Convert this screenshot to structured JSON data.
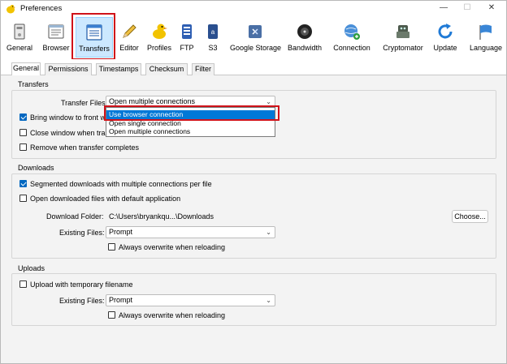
{
  "window": {
    "title": "Preferences",
    "controls": {
      "minimize": "—",
      "maximize": "☐",
      "close": "✕"
    }
  },
  "toolbar": {
    "items": [
      {
        "label": "General",
        "icon": "general-icon"
      },
      {
        "label": "Browser",
        "icon": "browser-icon"
      },
      {
        "label": "Transfers",
        "icon": "transfers-icon",
        "selected": true
      },
      {
        "label": "Editor",
        "icon": "editor-icon"
      },
      {
        "label": "Profiles",
        "icon": "profiles-icon"
      },
      {
        "label": "FTP",
        "icon": "ftp-icon"
      },
      {
        "label": "S3",
        "icon": "s3-icon"
      },
      {
        "label": "Google Storage",
        "icon": "google-storage-icon"
      },
      {
        "label": "Bandwidth",
        "icon": "bandwidth-icon"
      },
      {
        "label": "Connection",
        "icon": "connection-icon"
      },
      {
        "label": "Cryptomator",
        "icon": "cryptomator-icon"
      },
      {
        "label": "Update",
        "icon": "update-icon"
      },
      {
        "label": "Language",
        "icon": "language-icon"
      }
    ]
  },
  "tabs": [
    {
      "label": "General",
      "active": true
    },
    {
      "label": "Permissions"
    },
    {
      "label": "Timestamps"
    },
    {
      "label": "Checksum"
    },
    {
      "label": "Filter"
    }
  ],
  "transfers": {
    "title": "Transfers",
    "transfer_files_label": "Transfer Files:",
    "transfer_files_value": "Open multiple connections",
    "bring_window": {
      "label": "Bring window to front w",
      "checked": true
    },
    "close_window": {
      "label": "Close window when tran",
      "checked": false
    },
    "remove_when_complete": {
      "label": "Remove when transfer completes",
      "checked": false
    },
    "dropdown_options": [
      {
        "label": "Use browser connection",
        "highlighted": true
      },
      {
        "label": "Open single connection"
      },
      {
        "label": "Open multiple connections"
      }
    ]
  },
  "downloads": {
    "title": "Downloads",
    "segmented": {
      "label": "Segmented downloads with multiple connections per file",
      "checked": true
    },
    "open_downloaded": {
      "label": "Open downloaded files with default application",
      "checked": false
    },
    "folder_label": "Download Folder:",
    "folder_value": "C:\\Users\\bryankqu...\\Downloads",
    "choose_button": "Choose...",
    "existing_files_label": "Existing Files:",
    "existing_files_value": "Prompt",
    "always_overwrite": {
      "label": "Always overwrite when reloading",
      "checked": false
    }
  },
  "uploads": {
    "title": "Uploads",
    "temp_filename": {
      "label": "Upload with temporary filename",
      "checked": false
    },
    "existing_files_label": "Existing Files:",
    "existing_files_value": "Prompt",
    "always_overwrite": {
      "label": "Always overwrite when reloading",
      "checked": false
    }
  },
  "colors": {
    "accent": "#0078d7",
    "annotation": "#d0121a",
    "selected_tab_bg": "#cce8ff"
  }
}
